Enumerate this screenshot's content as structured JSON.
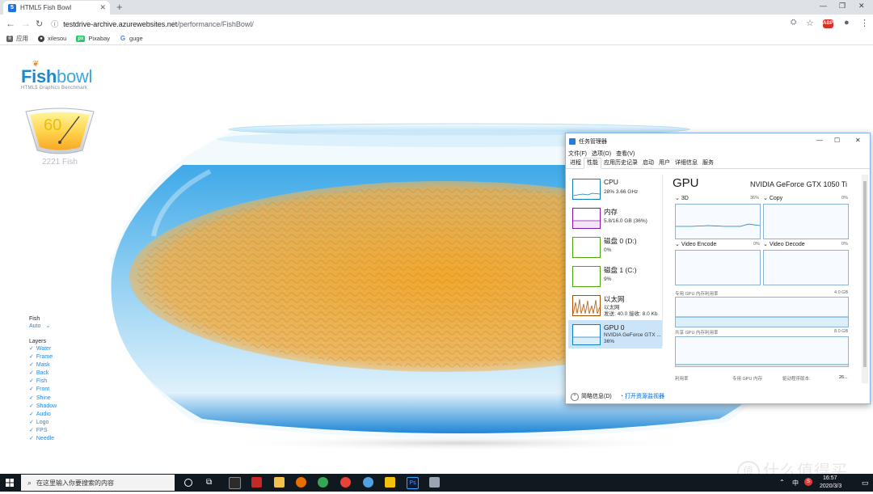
{
  "browser": {
    "tab_title": "HTML5 Fish Bowl",
    "new_tab": "+",
    "url_host": "testdrive-archive.azurewebsites.net",
    "url_path": "/performance/FishBowl/",
    "bookmarks": [
      {
        "label": "应用"
      },
      {
        "label": "xilesou"
      },
      {
        "label": "Pixabay"
      },
      {
        "label": "guge"
      }
    ]
  },
  "app": {
    "logo_word_a": "Fish",
    "logo_word_b": "bowl",
    "logo_sub": "HTML5 Graphics Benchmark",
    "fps": "60",
    "fish_count": "2221 Fish",
    "fish_label": "Fish",
    "fish_value": "Auto",
    "layers_label": "Layers",
    "layers": [
      "Water",
      "Frame",
      "Mask",
      "Back",
      "Fish",
      "Front",
      "Shine",
      "Shadow",
      "Audio",
      "Logo",
      "FPS",
      "Needle"
    ]
  },
  "taskmgr": {
    "title": "任务管理器",
    "menu": [
      "文件(F)",
      "选项(O)",
      "查看(V)"
    ],
    "tabs": [
      "进程",
      "性能",
      "应用历史记录",
      "启动",
      "用户",
      "详细信息",
      "服务"
    ],
    "resources": [
      {
        "name": "CPU",
        "stat": "28%  3.66 GHz",
        "stat2": "",
        "color": "#117dbb"
      },
      {
        "name": "内存",
        "stat": "5.8/16.0 GB (36%)",
        "stat2": "",
        "color": "#8b12ae"
      },
      {
        "name": "磁盘 0 (D:)",
        "stat": "0%",
        "stat2": "",
        "color": "#4da60c"
      },
      {
        "name": "磁盘 1 (C:)",
        "stat": "9%",
        "stat2": "",
        "color": "#4da60c"
      },
      {
        "name": "以太网",
        "stat": "以太网",
        "stat2": "发送: 40.0  接收: 8.0 Kb",
        "color": "#a74f01"
      },
      {
        "name": "GPU 0",
        "stat": "NVIDIA GeForce GTX ...",
        "stat2": "36%",
        "color": "#117dbb"
      }
    ],
    "gpu_title": "GPU",
    "gpu_model": "NVIDIA GeForce GTX 1050 Ti",
    "engines": [
      {
        "name": "3D",
        "pct": "36%"
      },
      {
        "name": "Copy",
        "pct": "0%"
      },
      {
        "name": "Video Encode",
        "pct": "0%"
      },
      {
        "name": "Video Decode",
        "pct": "0%"
      }
    ],
    "dedicated_label": "专用 GPU 内存利用率",
    "dedicated_max": "4.0 GB",
    "shared_label": "共享 GPU 内存利用率",
    "shared_max": "8.0 GB",
    "footer_util": "利用率",
    "footer_dedicated": "专用 GPU 内存",
    "footer_driver": "驱动程序版本:",
    "footer_driver_val": "26...",
    "brief_info": "简略信息(D)",
    "open_monitor": "打开资源监视器"
  },
  "taskbar": {
    "search_placeholder": "在这里输入你要搜索的内容",
    "clock_time": "16:57",
    "clock_date": "2020/3/3",
    "ime": "中",
    "ime2": "S"
  },
  "watermark": {
    "circle": "值",
    "text": "什么值得买"
  }
}
